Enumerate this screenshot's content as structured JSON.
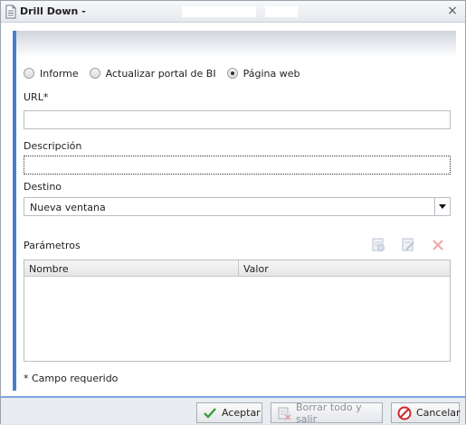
{
  "window": {
    "title": "Drill Down -",
    "close_glyph": "×"
  },
  "link_type": {
    "options": [
      {
        "label": "Informe",
        "checked": false
      },
      {
        "label": "Actualizar portal de BI",
        "checked": false
      },
      {
        "label": "Página web",
        "checked": true
      }
    ]
  },
  "url": {
    "label": "URL*",
    "value": ""
  },
  "description": {
    "label": "Descripción",
    "value": ""
  },
  "target": {
    "label": "Destino",
    "value": "Nueva ventana"
  },
  "parameters": {
    "label": "Parámetros",
    "columns": [
      "Nombre",
      "Valor"
    ],
    "rows": []
  },
  "required_note": "* Campo requerido",
  "footer": {
    "accept": "Aceptar",
    "clear_exit": "Borrar todo y salir",
    "cancel": "Cancelar"
  },
  "colors": {
    "accent": "#4a7fc8",
    "footer_border": "#7ea6de",
    "delete_red": "#e05050",
    "accept_green": "#2f9a2f"
  }
}
